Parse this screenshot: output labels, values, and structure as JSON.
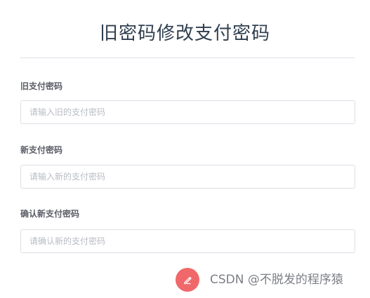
{
  "page": {
    "title": "旧密码修改支付密码"
  },
  "form": {
    "fields": [
      {
        "label": "旧支付密码",
        "placeholder": "请输入旧的支付密码",
        "value": ""
      },
      {
        "label": "新支付密码",
        "placeholder": "请输入新的支付密码",
        "value": ""
      },
      {
        "label": "确认新支付密码",
        "placeholder": "请确认新的支付密码",
        "value": ""
      }
    ]
  },
  "watermark": {
    "text": "CSDN @不脱发的程序猿",
    "icon": "pen-icon",
    "badge_color": "#f0686a"
  },
  "colors": {
    "title": "#2f3e4f",
    "label": "#5a5e66",
    "border": "#dcdfe6",
    "placeholder": "#b8bcc4"
  }
}
